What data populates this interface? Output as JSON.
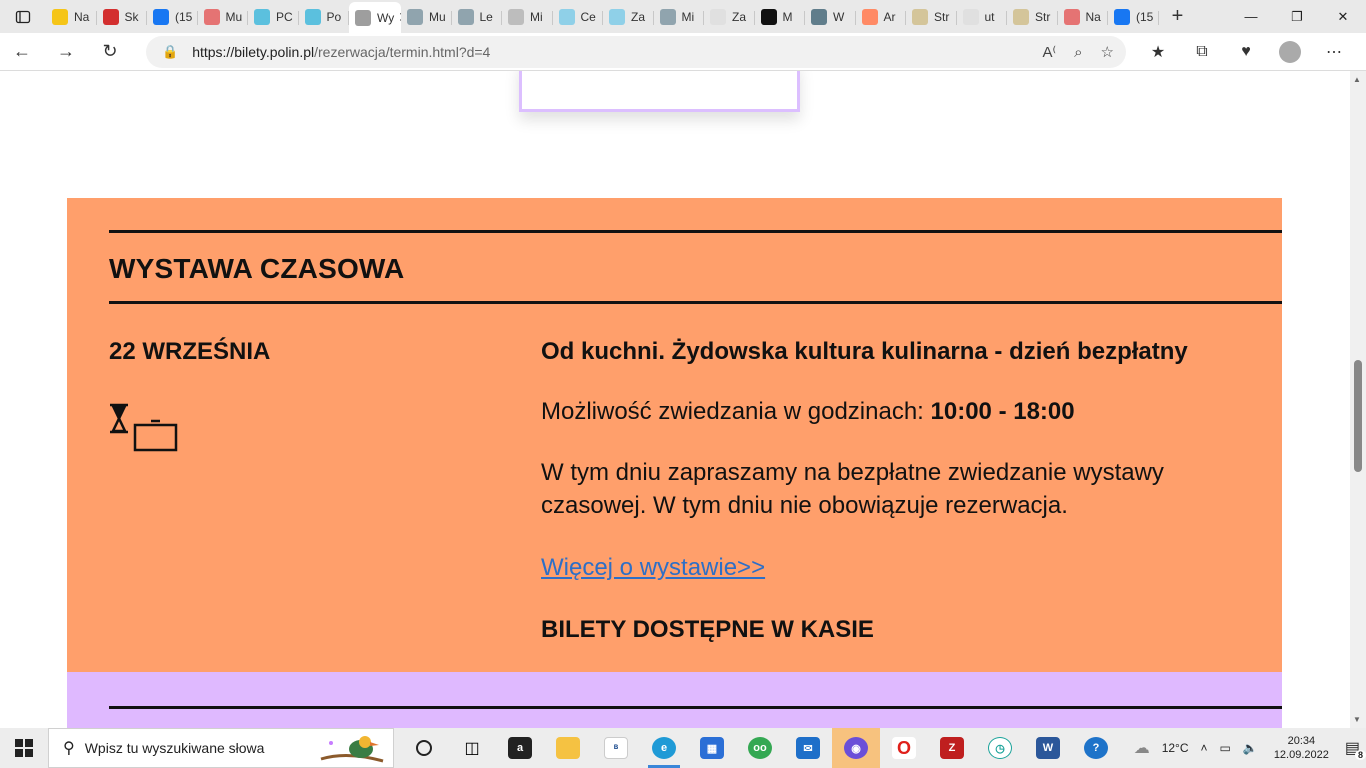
{
  "browser": {
    "tabs": [
      {
        "label": "Na",
        "icon": "notification-2-icon",
        "color": "#f5c518"
      },
      {
        "label": "Sk",
        "icon": "ticket-icon",
        "color": "#d32f2f"
      },
      {
        "label": "(15",
        "icon": "facebook-icon",
        "color": "#1877f2"
      },
      {
        "label": "Mu",
        "icon": "museum-icon",
        "color": "#e57373"
      },
      {
        "label": "PC",
        "icon": "polin-icon",
        "color": "#5bc0de"
      },
      {
        "label": "Po",
        "icon": "polin-icon",
        "color": "#5bc0de"
      },
      {
        "label": "Wy",
        "icon": "polin-icon",
        "color": "#9e9e9e",
        "active": true
      },
      {
        "label": "Mu",
        "icon": "shield-icon",
        "color": "#90a4ae"
      },
      {
        "label": "Le",
        "icon": "shield-icon",
        "color": "#90a4ae"
      },
      {
        "label": "Mi",
        "icon": "museum-icon",
        "color": "#bdbdbd"
      },
      {
        "label": "Ce",
        "icon": "polin-icon",
        "color": "#8fd0e8"
      },
      {
        "label": "Za",
        "icon": "polin-icon",
        "color": "#8fd0e8"
      },
      {
        "label": "Mi",
        "icon": "shield-icon",
        "color": "#90a4ae"
      },
      {
        "label": "Za",
        "icon": "page-icon",
        "color": "#e0e0e0"
      },
      {
        "label": "M",
        "icon": "letter-l-icon",
        "color": "#111111"
      },
      {
        "label": "W",
        "icon": "nbp-icon",
        "color": "#607d8b"
      },
      {
        "label": "Ar",
        "icon": "cross-icon",
        "color": "#ff8a65"
      },
      {
        "label": "Str",
        "icon": "coin-icon",
        "color": "#d4c59a"
      },
      {
        "label": "ut",
        "icon": "google-icon",
        "color": "#e0e0e0"
      },
      {
        "label": "Str",
        "icon": "coin-icon",
        "color": "#d4c59a"
      },
      {
        "label": "Na",
        "icon": "emblem-icon",
        "color": "#e57373"
      },
      {
        "label": "(15",
        "icon": "facebook-icon",
        "color": "#1877f2"
      }
    ],
    "url_host": "https://bilety.polin.pl",
    "url_path": "/rezerwacja/termin.html?d=4"
  },
  "section": {
    "title": "WYSTAWA CZASOWA",
    "date": "22 WRZEŚNIA",
    "exhibition_title": "Od kuchni. Żydowska kultura kulinarna - dzień bezpłatny",
    "hours_label": "Możliwość zwiedzania w godzinach:",
    "hours_value": "10:00 - 18:00",
    "description": "W tym dniu zapraszamy na bezpłatne zwiedzanie wystawy czasowej. W tym dniu nie obowiązuje rezerwacja.",
    "more_link": "Więcej o wystawie>>",
    "tickets_note": "BILETY DOSTĘPNE W KASIE"
  },
  "colors": {
    "orange_section": "#ff9f6b",
    "purple_section": "#dfb9ff",
    "link": "#2d6fc7"
  },
  "taskbar": {
    "search_placeholder": "Wpisz tu wyszukiwane słowa",
    "weather": "12°C",
    "time": "20:34",
    "date": "12.09.2022",
    "notifications": "8"
  }
}
